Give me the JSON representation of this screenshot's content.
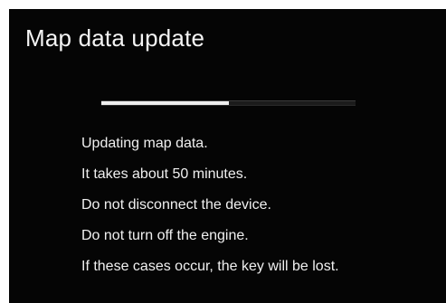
{
  "screen": {
    "title": "Map data update",
    "progress": {
      "value": 0.5
    },
    "messages": [
      "Updating map data.",
      "It takes about 50 minutes.",
      "Do not disconnect  the device.",
      "Do not turn off the engine.",
      "If these cases occur, the key will be lost."
    ]
  },
  "colors": {
    "background": "#050505",
    "text": "#f0f0f0",
    "progress_fill": "#eeeeee",
    "progress_track": "#1b1b1b"
  }
}
